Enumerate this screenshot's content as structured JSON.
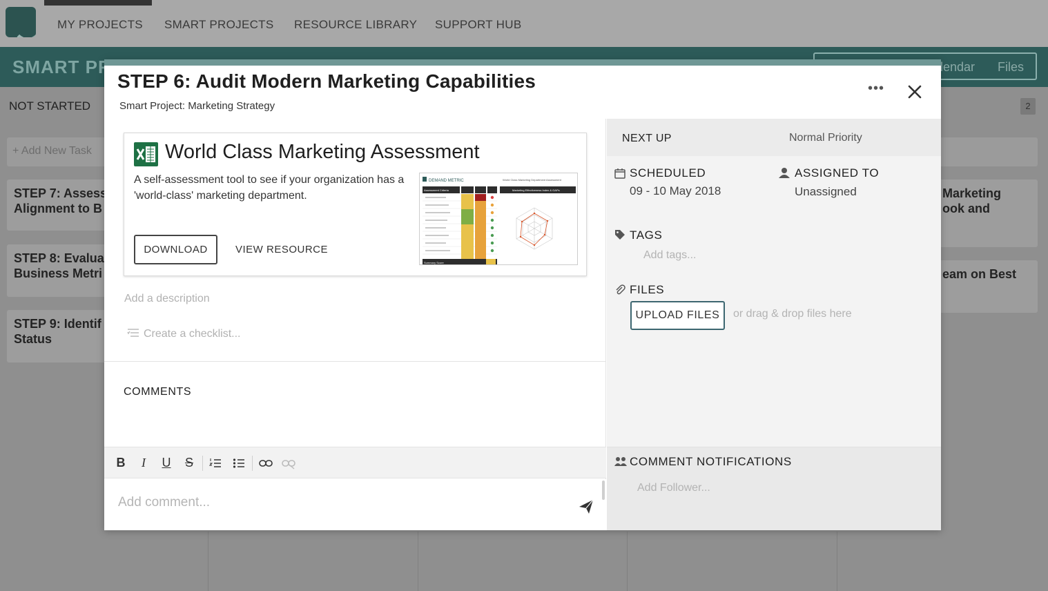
{
  "nav": {
    "items": [
      "MY PROJECTS",
      "SMART PROJECTS",
      "RESOURCE LIBRARY",
      "SUPPORT HUB"
    ]
  },
  "app": {
    "title": "SMART PR",
    "view_tabs": [
      "lendar",
      "Files"
    ]
  },
  "board": {
    "column_head": "NOT STARTED",
    "count": "2",
    "add_task": "+ Add New Task",
    "cards_left": [
      "STEP 7: Assess\nAlignment to B",
      "STEP 8: Evalua\nBusiness Metri",
      "STEP 9: Identif\nStatus"
    ],
    "cards_right": [
      "Marketing\nook and",
      "eam on Best"
    ]
  },
  "modal": {
    "title": "STEP 6: Audit Modern Marketing Capabilities",
    "subtitle": "Smart Project: Marketing Strategy",
    "more": "•••",
    "resource": {
      "title": "World Class Marketing Assessment",
      "description": "A self-assessment tool to see if your organization has a 'world-class' marketing department.",
      "download": "DOWNLOAD",
      "view": "VIEW RESOURCE",
      "icon": "excel-icon",
      "thumb_brand": "DEMAND METRIC",
      "thumb_title": "World Class Marketing Department Assessment",
      "thumb_col1": "Assessment Criteria",
      "thumb_col2": "Marketing Effectiveness Index & GAPs",
      "thumb_footer": "Summary Score"
    },
    "description_placeholder": "Add a description",
    "checklist_placeholder": "Create a checklist...",
    "comments_heading": "COMMENTS",
    "toolbar": {
      "bold": "B",
      "italic": "I",
      "underline": "U",
      "strike": "S"
    },
    "comment_placeholder": "Add comment...",
    "right": {
      "next_up": "NEXT UP",
      "priority": "Normal Priority",
      "scheduled_label": "SCHEDULED",
      "scheduled_value": "09 - 10 May 2018",
      "assigned_label": "ASSIGNED TO",
      "assigned_value": "Unassigned",
      "tags_label": "TAGS",
      "tags_placeholder": "Add tags...",
      "files_label": "FILES",
      "upload": "UPLOAD FILES",
      "drag_hint": "or drag & drop files here",
      "notifications_label": "COMMENT NOTIFICATIONS",
      "follower_placeholder": "Add Follower..."
    }
  },
  "colors": {
    "header_teal": "#2d5b59",
    "modal_strip": "#6f9795",
    "excel_green": "#1e7145",
    "upload_border": "#3c6670"
  }
}
